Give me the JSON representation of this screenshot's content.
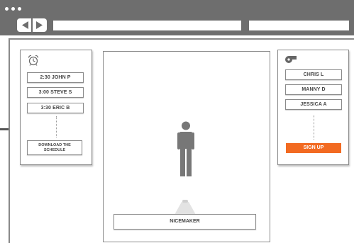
{
  "browser": {
    "window_dots": [
      "dot",
      "dot",
      "dot"
    ],
    "nav_icons": [
      "back-icon",
      "forward-icon"
    ],
    "url_value": "",
    "search_value": ""
  },
  "schedule_panel": {
    "icon": "alarm-clock-icon",
    "items": [
      {
        "label": "2:30 JOHN P"
      },
      {
        "label": "3:00 STEVE S"
      },
      {
        "label": "3:30 ERIC B"
      }
    ],
    "download_label_line1": "DOWNLOAD THE",
    "download_label_line2": "SCHEDULE"
  },
  "center": {
    "figure_icon": "person-icon",
    "spotlight_icon": "spotlight-icon",
    "name_label": "NICEMAKER"
  },
  "signup_panel": {
    "icon": "whistle-icon",
    "items": [
      {
        "label": "CHRIS L"
      },
      {
        "label": "MANNY D"
      },
      {
        "label": "JESSICA A"
      }
    ],
    "signup_label": "SIGN UP"
  },
  "colors": {
    "chrome": "#6e6e6e",
    "accent": "#f26a21",
    "figure": "#777777"
  }
}
